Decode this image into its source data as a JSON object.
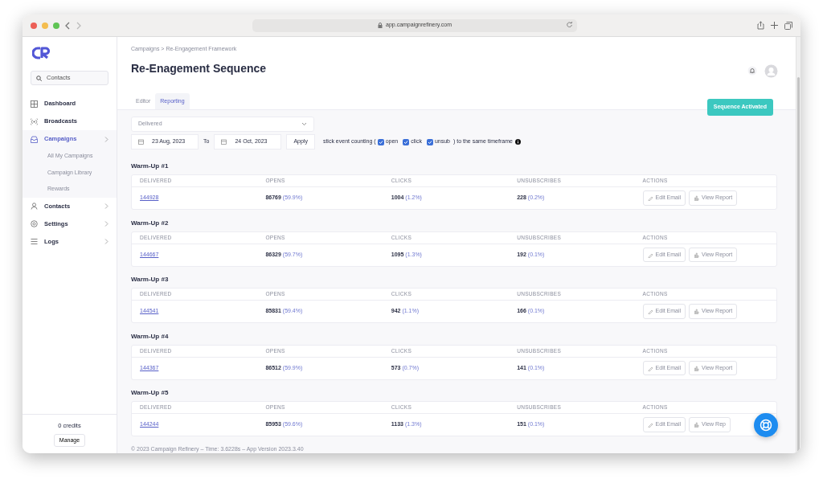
{
  "browser": {
    "url": "app.campaignrefinery.com"
  },
  "sidebar": {
    "search": {
      "placeholder": "Contacts"
    },
    "items": [
      {
        "label": "Dashboard",
        "kind": "link",
        "selected": false
      },
      {
        "label": "Broadcasts",
        "kind": "link",
        "selected": false
      },
      {
        "label": "Campaigns",
        "kind": "group",
        "selected": true,
        "children": [
          {
            "label": "All My Campaigns"
          },
          {
            "label": "Campaign Library"
          },
          {
            "label": "Rewards"
          }
        ]
      },
      {
        "label": "Contacts",
        "kind": "group",
        "selected": false
      },
      {
        "label": "Settings",
        "kind": "group",
        "selected": false
      },
      {
        "label": "Logs",
        "kind": "group",
        "selected": false
      }
    ],
    "credits": "0 credits",
    "manage": "Manage"
  },
  "breadcrumb": "Campaigns > Re-Engagement Framework",
  "title": "Re-Enagement Sequence",
  "tabs": [
    {
      "label": "Editor",
      "selected": false
    },
    {
      "label": "Reporting",
      "selected": true
    }
  ],
  "status_button": "Sequence Activated",
  "filter": {
    "metric": "Delivered",
    "from": "23 Aug, 2023",
    "to_label": "To",
    "to": "24 Oct, 2023",
    "apply": "Apply",
    "stick_prefix": "stick event counting (",
    "options": [
      {
        "label": "open",
        "checked": true
      },
      {
        "label": "click",
        "checked": true
      },
      {
        "label": "unsub",
        "checked": true
      }
    ],
    "stick_suffix": ") to the same timeframe"
  },
  "sections": [
    {
      "title": "Warm-Up #1",
      "columns": [
        "DELIVERED",
        "OPENS",
        "CLICKS",
        "UNSUBSCRIBES",
        "ACTIONS"
      ],
      "delivered": "144928",
      "opens": "86769",
      "opens_rate": "(59.9%)",
      "clicks": "1004",
      "clicks_rate": "(1.2%)",
      "unsubscribes": "228",
      "unsubscribes_rate": "(0.2%)",
      "actions": [
        "Edit Email",
        "View Report"
      ]
    },
    {
      "title": "Warm-Up #2",
      "columns": [
        "DELIVERED",
        "OPENS",
        "CLICKS",
        "UNSUBSCRIBES",
        "ACTIONS"
      ],
      "delivered": "144667",
      "opens": "86329",
      "opens_rate": "(59.7%)",
      "clicks": "1095",
      "clicks_rate": "(1.3%)",
      "unsubscribes": "192",
      "unsubscribes_rate": "(0.1%)",
      "actions": [
        "Edit Email",
        "View Report"
      ]
    },
    {
      "title": "Warm-Up #3",
      "columns": [
        "DELIVERED",
        "OPENS",
        "CLICKS",
        "UNSUBSCRIBES",
        "ACTIONS"
      ],
      "delivered": "144541",
      "opens": "85831",
      "opens_rate": "(59.4%)",
      "clicks": "942",
      "clicks_rate": "(1.1%)",
      "unsubscribes": "166",
      "unsubscribes_rate": "(0.1%)",
      "actions": [
        "Edit Email",
        "View Report"
      ]
    },
    {
      "title": "Warm-Up #4",
      "columns": [
        "DELIVERED",
        "OPENS",
        "CLICKS",
        "UNSUBSCRIBES",
        "ACTIONS"
      ],
      "delivered": "144367",
      "opens": "86512",
      "opens_rate": "(59.9%)",
      "clicks": "573",
      "clicks_rate": "(0.7%)",
      "unsubscribes": "141",
      "unsubscribes_rate": "(0.1%)",
      "actions": [
        "Edit Email",
        "View Report"
      ]
    },
    {
      "title": "Warm-Up #5",
      "columns": [
        "DELIVERED",
        "OPENS",
        "CLICKS",
        "UNSUBSCRIBES",
        "ACTIONS"
      ],
      "delivered": "144244",
      "opens": "85953",
      "opens_rate": "(59.6%)",
      "clicks": "1133",
      "clicks_rate": "(1.3%)",
      "unsubscribes": "151",
      "unsubscribes_rate": "(0.1%)",
      "actions": [
        "Edit Email",
        "View Rep"
      ]
    }
  ],
  "footer": "© 2023 Campaign Refinery – Time: 3.6228s – App Version 2023.3.40"
}
